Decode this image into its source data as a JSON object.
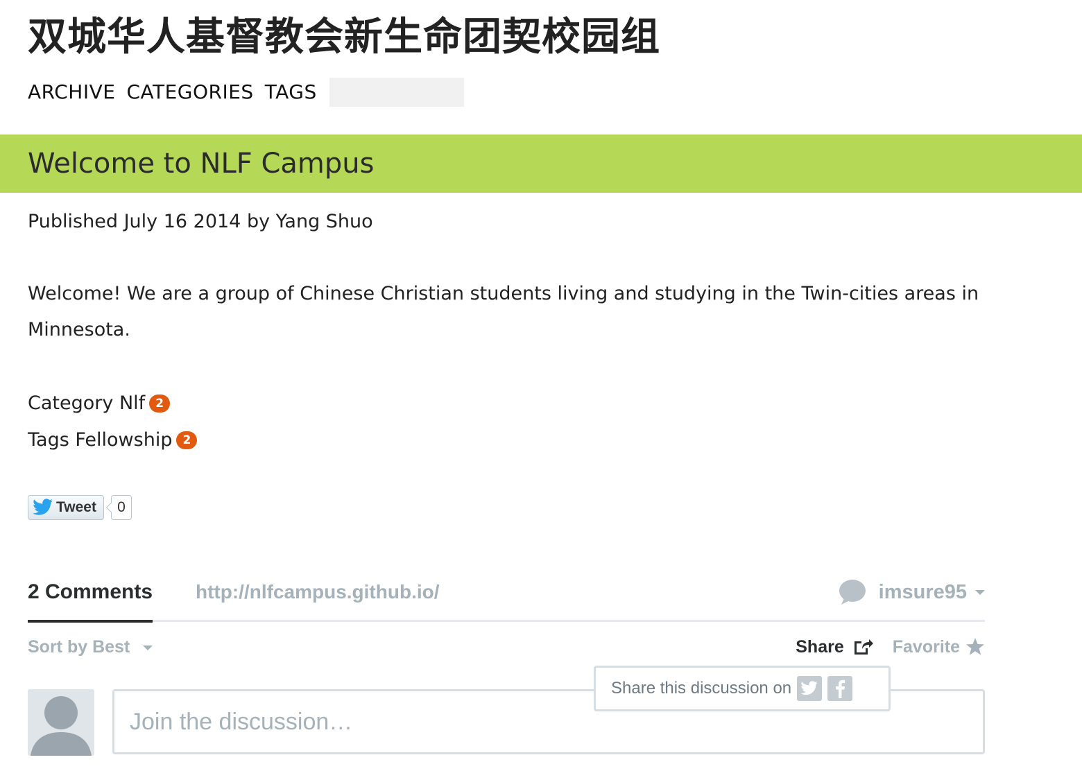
{
  "site": {
    "title": "双城华人基督教会新生命团契校园组"
  },
  "nav": {
    "items": [
      "ARCHIVE",
      "CATEGORIES",
      "TAGS"
    ],
    "search_placeholder": ""
  },
  "post": {
    "title": "Welcome to NLF Campus",
    "meta": "Published July 16 2014 by Yang Shuo",
    "body": "Welcome! We are a group of Chinese Christian students living and studying in the Twin-cities areas in Minnesota.",
    "category_label": "Category",
    "category_name": "Nlf",
    "category_count": "2",
    "tags_label": "Tags",
    "tag_name": "Fellowship",
    "tag_count": "2"
  },
  "tweet": {
    "label": "Tweet",
    "count": "0"
  },
  "disqus": {
    "comments_label": "2 Comments",
    "site_link": "http://nlfcampus.github.io/",
    "username": "imsure95",
    "sort_label": "Sort by Best",
    "share_label": "Share",
    "favorite_label": "Favorite",
    "share_popup_text": "Share this discussion on",
    "input_placeholder": "Join the discussion…"
  },
  "colors": {
    "banner": "#b5d957",
    "badge": "#e25a10",
    "muted": "#a5b2b9",
    "dark": "#2a2e2e"
  }
}
